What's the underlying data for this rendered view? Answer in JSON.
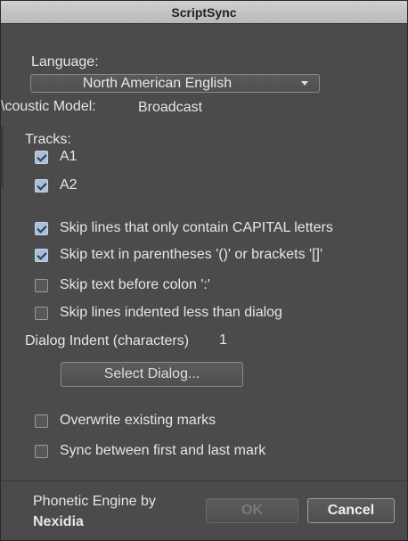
{
  "window": {
    "title": "ScriptSync"
  },
  "language": {
    "label": "Language:",
    "value": "North American English"
  },
  "acoustic": {
    "label": "\\coustic Model:",
    "value": "Broadcast"
  },
  "tracks": {
    "label": "Tracks:",
    "items": [
      {
        "label": "A1",
        "checked": true
      },
      {
        "label": "A2",
        "checked": true
      }
    ]
  },
  "options": [
    {
      "label": "Skip lines that only contain CAPITAL letters",
      "checked": true
    },
    {
      "label": "Skip text in parentheses '()' or brackets '[]'",
      "checked": true
    },
    {
      "label": "Skip text before colon ':'",
      "checked": false
    },
    {
      "label": "Skip lines indented less than dialog",
      "checked": false
    }
  ],
  "dialog_indent": {
    "label": "Dialog Indent (characters)",
    "value": "1"
  },
  "select_dialog": {
    "label": "Select Dialog..."
  },
  "marks": [
    {
      "label": "Overwrite existing marks",
      "checked": false
    },
    {
      "label": "Sync between first and last mark",
      "checked": false
    }
  ],
  "footer": {
    "credit_line1": "Phonetic Engine by",
    "credit_line2": "Nexidia",
    "ok_label": "OK",
    "cancel_label": "Cancel"
  }
}
